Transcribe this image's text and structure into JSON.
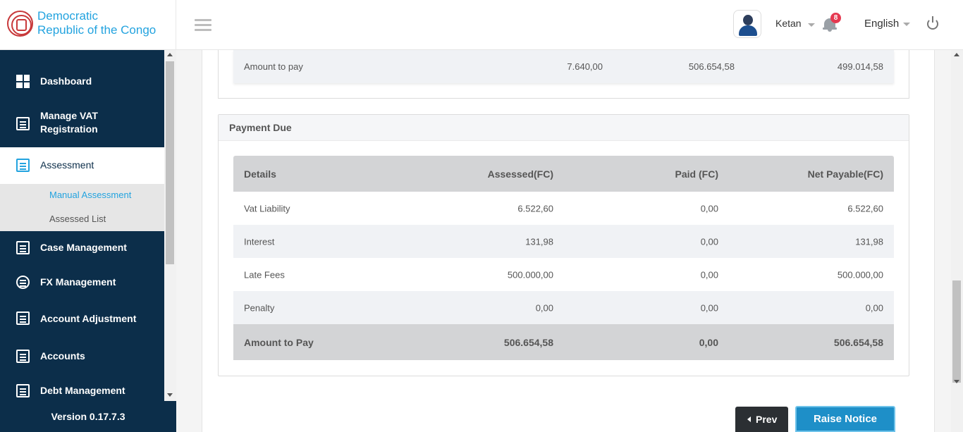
{
  "brand": {
    "line1": "Democratic",
    "line2": "Republic of the Congo"
  },
  "header": {
    "username": "Ketan",
    "notification_count": "8",
    "language": "English"
  },
  "sidebar": {
    "items": [
      {
        "label": "Dashboard",
        "icon": "dashboard-icon"
      },
      {
        "label_line1": "Manage VAT",
        "label_line2": "Registration",
        "icon": "clipboard-icon"
      },
      {
        "label": "Assessment",
        "icon": "document-search-icon"
      },
      {
        "label": "Case Management",
        "icon": "folder-icon"
      },
      {
        "label": "FX Management",
        "icon": "currency-exchange-icon"
      },
      {
        "label": "Account Adjustment",
        "icon": "calculator-icon"
      },
      {
        "label": "Accounts",
        "icon": "receipt-icon"
      },
      {
        "label": "Debt Management",
        "icon": "debt-icon"
      }
    ],
    "submenu": [
      "Manual Assessment",
      "Assessed List"
    ],
    "version": "Version 0.17.7.3"
  },
  "top_table": {
    "label": "Amount to pay",
    "values": [
      "7.640,00",
      "506.654,58",
      "499.014,58"
    ]
  },
  "payment_due": {
    "title": "Payment Due",
    "headers": [
      "Details",
      "Assessed(FC)",
      "Paid (FC)",
      "Net Payable(FC)"
    ],
    "rows": [
      [
        "Vat Liability",
        "6.522,60",
        "0,00",
        "6.522,60"
      ],
      [
        "Interest",
        "131,98",
        "0,00",
        "131,98"
      ],
      [
        "Late Fees",
        "500.000,00",
        "0,00",
        "500.000,00"
      ],
      [
        "Penalty",
        "0,00",
        "0,00",
        "0,00"
      ]
    ],
    "footer": [
      "Amount to Pay",
      "506.654,58",
      "0,00",
      "506.654,58"
    ]
  },
  "buttons": {
    "prev": "Prev",
    "raise_notice": "Raise Notice"
  },
  "colors": {
    "sidebar_bg": "#0c2e4a",
    "accent": "#23a3df",
    "primary_button": "#1e8fc8",
    "dark_button": "#2b2f33",
    "badge": "#e53950"
  }
}
